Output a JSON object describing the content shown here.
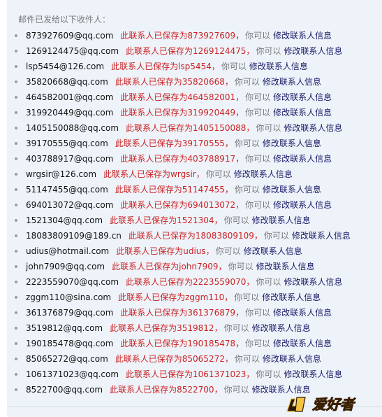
{
  "header": {
    "title": "邮件已发给以下收件人："
  },
  "recipients": [
    {
      "email": "873927609@qq.com",
      "saved": "此联系人已保存为873927609"
    },
    {
      "email": "1269124475@qq.com",
      "saved": "此联系人已保存为1269124475"
    },
    {
      "email": "lsp5454@126.com",
      "saved": "此联系人已保存为lsp5454"
    },
    {
      "email": "35820668@qq.com",
      "saved": "此联系人已保存为35820668"
    },
    {
      "email": "464582001@qq.com",
      "saved": "此联系人已保存为464582001"
    },
    {
      "email": "319920449@qq.com",
      "saved": "此联系人已保存为319920449"
    },
    {
      "email": "1405150088@qq.com",
      "saved": "此联系人已保存为1405150088"
    },
    {
      "email": "39170555@qq.com",
      "saved": "此联系人已保存为39170555"
    },
    {
      "email": "403788917@qq.com",
      "saved": "此联系人已保存为403788917"
    },
    {
      "email": "wrgsir@126.com",
      "saved": "此联系人已保存为wrgsir"
    },
    {
      "email": "51147455@qq.com",
      "saved": "此联系人已保存为51147455"
    },
    {
      "email": "694013072@qq.com",
      "saved": "此联系人已保存为694013072"
    },
    {
      "email": "1521304@qq.com",
      "saved": "此联系人已保存为1521304"
    },
    {
      "email": "18083809109@189.cn",
      "saved": "此联系人已保存为18083809109"
    },
    {
      "email": "udius@hotmail.com",
      "saved": "此联系人已保存为udius"
    },
    {
      "email": "john7909@qq.com",
      "saved": "此联系人已保存为john7909"
    },
    {
      "email": "2223559070@qq.com",
      "saved": "此联系人已保存为2223559070"
    },
    {
      "email": "zggm110@sina.com",
      "saved": "此联系人已保存为zggm110"
    },
    {
      "email": "361376879@qq.com",
      "saved": "此联系人已保存为361376879"
    },
    {
      "email": "3519812@qq.com",
      "saved": "此联系人已保存为3519812"
    },
    {
      "email": "190185478@qq.com",
      "saved": "此联系人已保存为190185478"
    },
    {
      "email": "85065272@qq.com",
      "saved": "此联系人已保存为85065272"
    },
    {
      "email": "1061371023@qq.com",
      "saved": "此联系人已保存为1061371023"
    },
    {
      "email": "8522700@qq.com",
      "saved": "此联系人已保存为8522700"
    }
  ],
  "common": {
    "comma": "，",
    "you_can": "你可以",
    "edit_link": "修改联系人信息"
  },
  "watermark": {
    "text": "爱好者",
    "accent": "#f5a623"
  },
  "colors": {
    "panel_bg": "#eef3fa",
    "saved_text": "#cc2222",
    "link_text": "#1a1a66",
    "muted_text": "#777777"
  }
}
